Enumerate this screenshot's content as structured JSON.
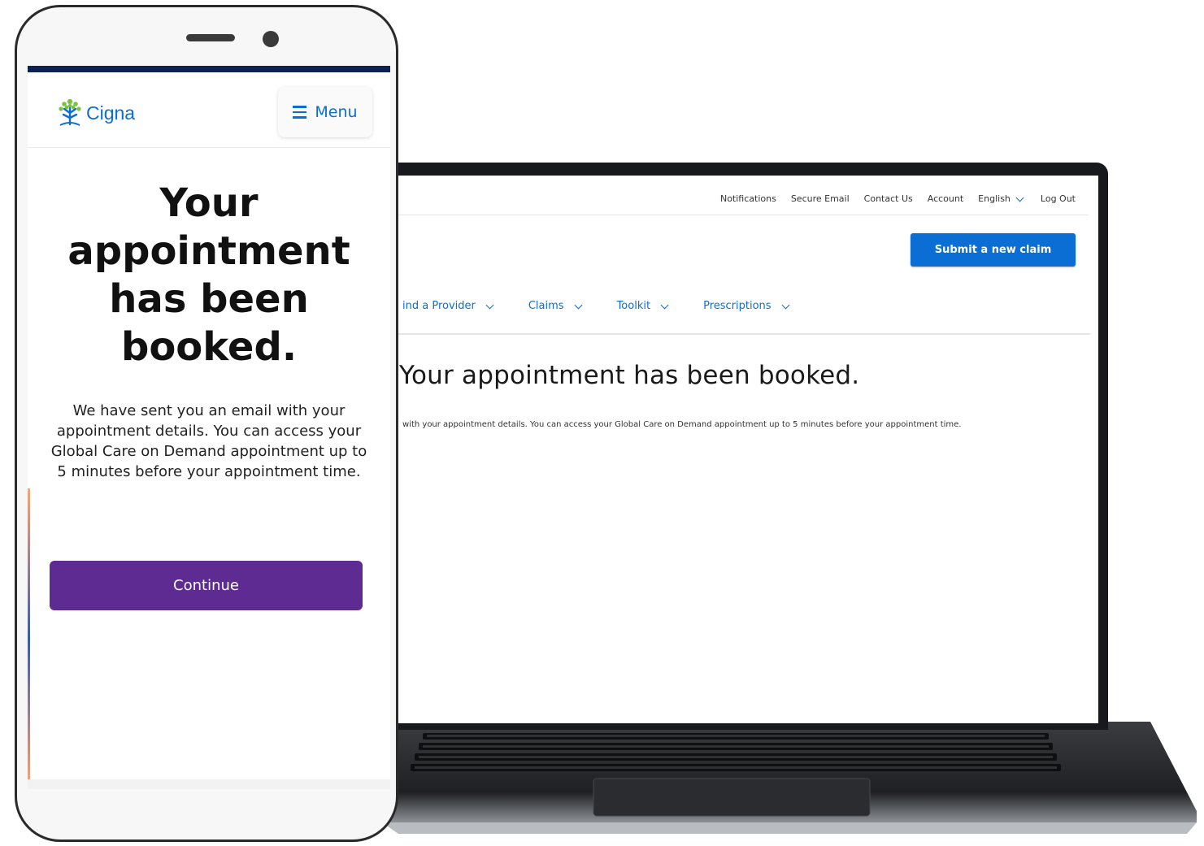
{
  "colors": {
    "brand_blue": "#0b6ed4",
    "continue_purple": "#5e2b92",
    "header_navy": "#0d2154",
    "device_dark": "#17191c"
  },
  "phone": {
    "brand": {
      "name": "Cigna",
      "icon": "cigna-tree-logo"
    },
    "menu_label": "Menu",
    "heading": "Your appointment has been booked.",
    "body": "We have sent you an email with your appointment details. You can access your Global Care on Demand appointment up to 5 minutes before your appointment time.",
    "continue_label": "Continue"
  },
  "laptop": {
    "utility_nav": {
      "notifications": "Notifications",
      "secure_email": "Secure Email",
      "contact_us": "Contact Us",
      "account": "Account",
      "language": "English",
      "log_out": "Log Out"
    },
    "submit_claim_label": "Submit a new claim",
    "main_nav": {
      "find_provider": "ind a Provider",
      "claims": "Claims",
      "toolkit": "Toolkit",
      "prescriptions": "Prescriptions"
    },
    "heading": "Your appointment has been booked.",
    "body": "with your appointment details. You can access your Global Care on Demand appointment up to 5 minutes before your appointment time."
  }
}
